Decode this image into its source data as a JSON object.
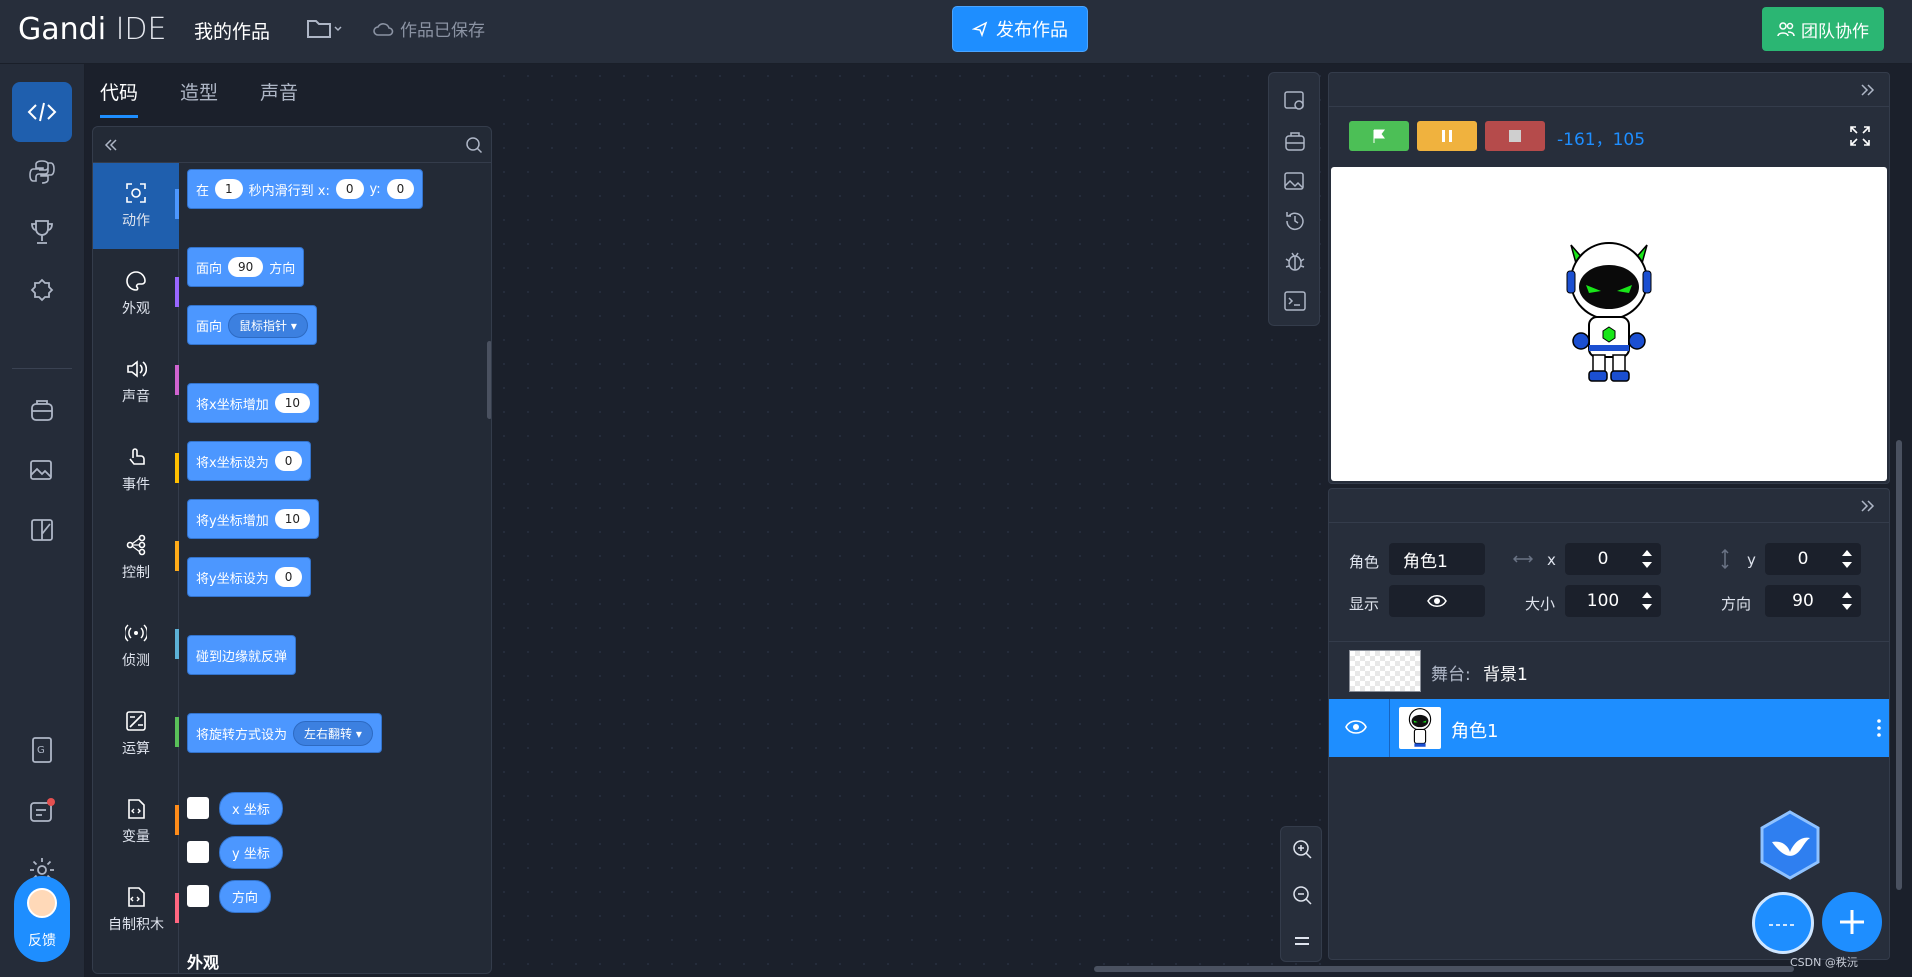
{
  "header": {
    "logo_main": "Gandi",
    "logo_sub": "IDE",
    "project_title": "我的作品",
    "saved_status": "作品已保存",
    "publish_label": "发布作品",
    "team_label": "团队协作"
  },
  "tabs": [
    "代码",
    "造型",
    "声音"
  ],
  "categories": [
    {
      "label": "动作",
      "color": "#4c97ff"
    },
    {
      "label": "外观",
      "color": "#9966ff"
    },
    {
      "label": "声音",
      "color": "#cf63cf"
    },
    {
      "label": "事件",
      "color": "#ffbf00"
    },
    {
      "label": "控制",
      "color": "#ffab19"
    },
    {
      "label": "侦测",
      "color": "#5cb1d6"
    },
    {
      "label": "运算",
      "color": "#59c059"
    },
    {
      "label": "变量",
      "color": "#ff8c1a"
    },
    {
      "label": "自制积木",
      "color": "#ff6680"
    }
  ],
  "blocks": {
    "glide": {
      "t1": "在",
      "v1": "1",
      "t2": "秒内滑行到 x:",
      "v2": "0",
      "t3": "y:",
      "v3": "0"
    },
    "point_dir": {
      "t1": "面向",
      "v1": "90",
      "t2": "方向"
    },
    "point_towards": {
      "t1": "面向",
      "d1": "鼠标指针"
    },
    "change_x": {
      "t1": "将x坐标增加",
      "v1": "10"
    },
    "set_x": {
      "t1": "将x坐标设为",
      "v1": "0"
    },
    "change_y": {
      "t1": "将y坐标增加",
      "v1": "10"
    },
    "set_y": {
      "t1": "将y坐标设为",
      "v1": "0"
    },
    "bounce": "碰到边缘就反弹",
    "rotation": {
      "t1": "将旋转方式设为",
      "d1": "左右翻转"
    },
    "reporters": [
      "x 坐标",
      "y 坐标",
      "方向"
    ],
    "section_next": "外观"
  },
  "stage": {
    "coords": "-161，105"
  },
  "sprite_info": {
    "sprite_label": "角色",
    "sprite_name": "角色1",
    "x_label": "x",
    "x_value": "0",
    "y_label": "y",
    "y_value": "0",
    "show_label": "显示",
    "size_label": "大小",
    "size_value": "100",
    "direction_label": "方向",
    "direction_value": "90"
  },
  "stage_row": {
    "prefix": "舞台:",
    "name": "背景1"
  },
  "sprite_list": [
    {
      "name": "角色1"
    }
  ],
  "feedback_label": "反馈",
  "credit": "CSDN @秩沅",
  "colors": {
    "accent": "#1e8eff",
    "green": "#2bb673",
    "flag": "#4cbf56",
    "pause": "#f0b23e",
    "stop": "#b54b4b"
  }
}
